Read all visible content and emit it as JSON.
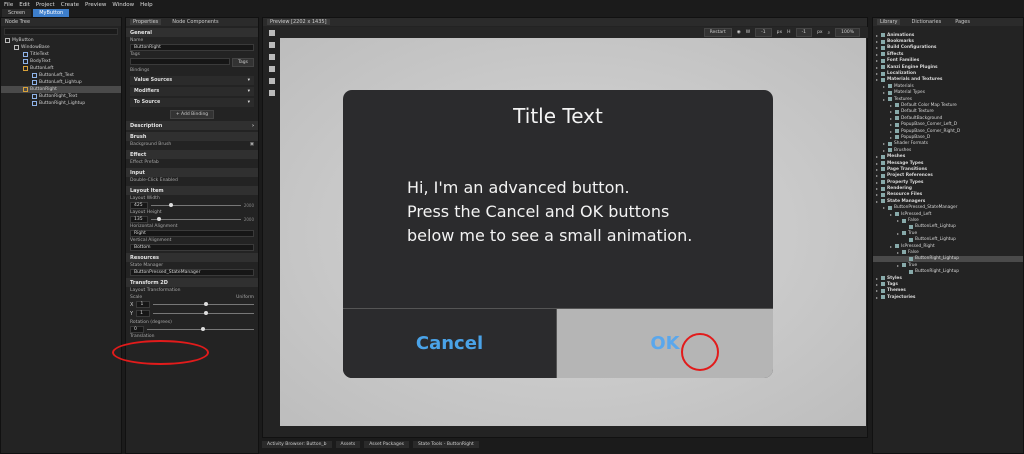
{
  "menubar": [
    "File",
    "Edit",
    "Project",
    "Create",
    "Preview",
    "Window",
    "Help"
  ],
  "toptabs": [
    "Screen",
    "MyButton"
  ],
  "nodetree": {
    "title": "Node Tree",
    "items": [
      {
        "label": "MyButton",
        "depth": 0,
        "icon": "win"
      },
      {
        "label": "WindowBase",
        "depth": 1,
        "icon": "win"
      },
      {
        "label": "TitleText",
        "depth": 2,
        "icon": "tx"
      },
      {
        "label": "BodyText",
        "depth": 2,
        "icon": "tx"
      },
      {
        "label": "ButtonLeft",
        "depth": 2,
        "icon": "btn"
      },
      {
        "label": "ButtonLeft_Text",
        "depth": 3,
        "icon": "tx"
      },
      {
        "label": "ButtonLeft_Lightup",
        "depth": 3,
        "icon": "tx"
      },
      {
        "label": "ButtonRight",
        "depth": 2,
        "icon": "btn",
        "selected": true
      },
      {
        "label": "ButtonRight_Text",
        "depth": 3,
        "icon": "tx"
      },
      {
        "label": "ButtonRight_Lightup",
        "depth": 3,
        "icon": "tx"
      }
    ]
  },
  "props": {
    "tab1": "Properties",
    "tab2": "Node Components",
    "general": "General",
    "name_label": "Name",
    "name_value": "ButtonRight",
    "tags_label": "Tags",
    "tags_btn": "Tags",
    "bindings_label": "Bindings",
    "value_sources": "Value Sources",
    "modifiers": "Modifiers",
    "to_source": "To Source",
    "add_binding": "+ Add Binding",
    "description": "Description",
    "brush": "Brush",
    "background_brush": "Background Brush",
    "effect": "Effect",
    "effect_prefab": "Effect Prefab",
    "input": "Input",
    "double_click": "Double-Click Enabled",
    "layout_item": "Layout Item",
    "layout_width": "Layout Width",
    "width_value": "425",
    "width_max": "2000",
    "layout_height": "Layout Height",
    "height_value": "135",
    "height_max": "2000",
    "h_align": "Horizontal Alignment",
    "h_align_value": "Right",
    "v_align": "Vertical Alignment",
    "v_align_value": "Bottom",
    "resources": "Resources",
    "state_manager": "State Manager",
    "state_manager_value": "ButtonPressed_StateManager",
    "transform2d": "Transform 2D",
    "layout_transformation": "Layout Transformation",
    "scale": "Scale",
    "uniform": "Uniform",
    "x_label": "X",
    "y_label": "Y",
    "x_scale": "1",
    "y_scale": "1",
    "rotation": "Rotation (degrees)",
    "rotation_value": "0",
    "translation": "Translation"
  },
  "preview": {
    "tab": "Preview [2202 x 1435]",
    "restart": "Restart",
    "w": "W",
    "h": "H",
    "w_val": "-1",
    "h_val": "-1",
    "px": "px",
    "zoom": "100%"
  },
  "dialog": {
    "title": "Title Text",
    "body": [
      "Hi, I'm an advanced button.",
      "Press the Cancel and OK buttons",
      "below me to see a small animation."
    ],
    "cancel": "Cancel",
    "ok": "OK"
  },
  "bottomtabs": [
    "Activity Browser: Button_b",
    "Assets",
    "Asset Packages",
    "State Tools - ButtonRight"
  ],
  "library": {
    "tabs": [
      "Library",
      "Dictionaries",
      "Pages"
    ],
    "rows": [
      {
        "label": "Animations",
        "depth": 0,
        "bold": true
      },
      {
        "label": "Bookmarks",
        "depth": 0,
        "bold": true
      },
      {
        "label": "Build Configurations",
        "depth": 0,
        "bold": true
      },
      {
        "label": "Effects",
        "depth": 0,
        "bold": true
      },
      {
        "label": "Font Families",
        "depth": 0,
        "bold": true
      },
      {
        "label": "Kanzi Engine Plugins",
        "depth": 0,
        "bold": true
      },
      {
        "label": "Localization",
        "depth": 0,
        "bold": true
      },
      {
        "label": "Materials and Textures",
        "depth": 0,
        "bold": true
      },
      {
        "label": "Materials",
        "depth": 1
      },
      {
        "label": "Material Types",
        "depth": 1
      },
      {
        "label": "Textures",
        "depth": 1
      },
      {
        "label": "Default Color Map Texture",
        "depth": 2
      },
      {
        "label": "Default Texture",
        "depth": 2
      },
      {
        "label": "DefaultBackground",
        "depth": 2
      },
      {
        "label": "PopupBase_Corner_Left_D",
        "depth": 2
      },
      {
        "label": "PopupBase_Corner_Right_D",
        "depth": 2
      },
      {
        "label": "PopupBase_D",
        "depth": 2
      },
      {
        "label": "Shader Formats",
        "depth": 1
      },
      {
        "label": "Brushes",
        "depth": 1
      },
      {
        "label": "Meshes",
        "depth": 0,
        "bold": true
      },
      {
        "label": "Message Types",
        "depth": 0,
        "bold": true
      },
      {
        "label": "Page Transitions",
        "depth": 0,
        "bold": true
      },
      {
        "label": "Project References",
        "depth": 0,
        "bold": true
      },
      {
        "label": "Property Types",
        "depth": 0,
        "bold": true
      },
      {
        "label": "Rendering",
        "depth": 0,
        "bold": true
      },
      {
        "label": "Resource Files",
        "depth": 0,
        "bold": true
      },
      {
        "label": "State Managers",
        "depth": 0,
        "bold": true
      },
      {
        "label": "ButtonPressed_StateManager",
        "depth": 1
      },
      {
        "label": "IsPressed_Left",
        "depth": 2
      },
      {
        "label": "False",
        "depth": 3
      },
      {
        "label": "ButtonLeft_Lightup",
        "depth": 4
      },
      {
        "label": "True",
        "depth": 3
      },
      {
        "label": "ButtonLeft_Lightup",
        "depth": 4
      },
      {
        "label": "IsPressed_Right",
        "depth": 2
      },
      {
        "label": "False",
        "depth": 3
      },
      {
        "label": "ButtonRight_Lightup",
        "depth": 4,
        "selected": true
      },
      {
        "label": "True",
        "depth": 3
      },
      {
        "label": "ButtonRight_Lightup",
        "depth": 4
      },
      {
        "label": "Styles",
        "depth": 0,
        "bold": true
      },
      {
        "label": "Tags",
        "depth": 0,
        "bold": true
      },
      {
        "label": "Themes",
        "depth": 0,
        "bold": true
      },
      {
        "label": "Trajectories",
        "depth": 0,
        "bold": true
      }
    ]
  },
  "colors": {
    "accent": "#3d7ecb",
    "cancel_text": "#4aa3e8",
    "ok_bg": "#b5b5b5",
    "annotation": "#e21b1b"
  }
}
